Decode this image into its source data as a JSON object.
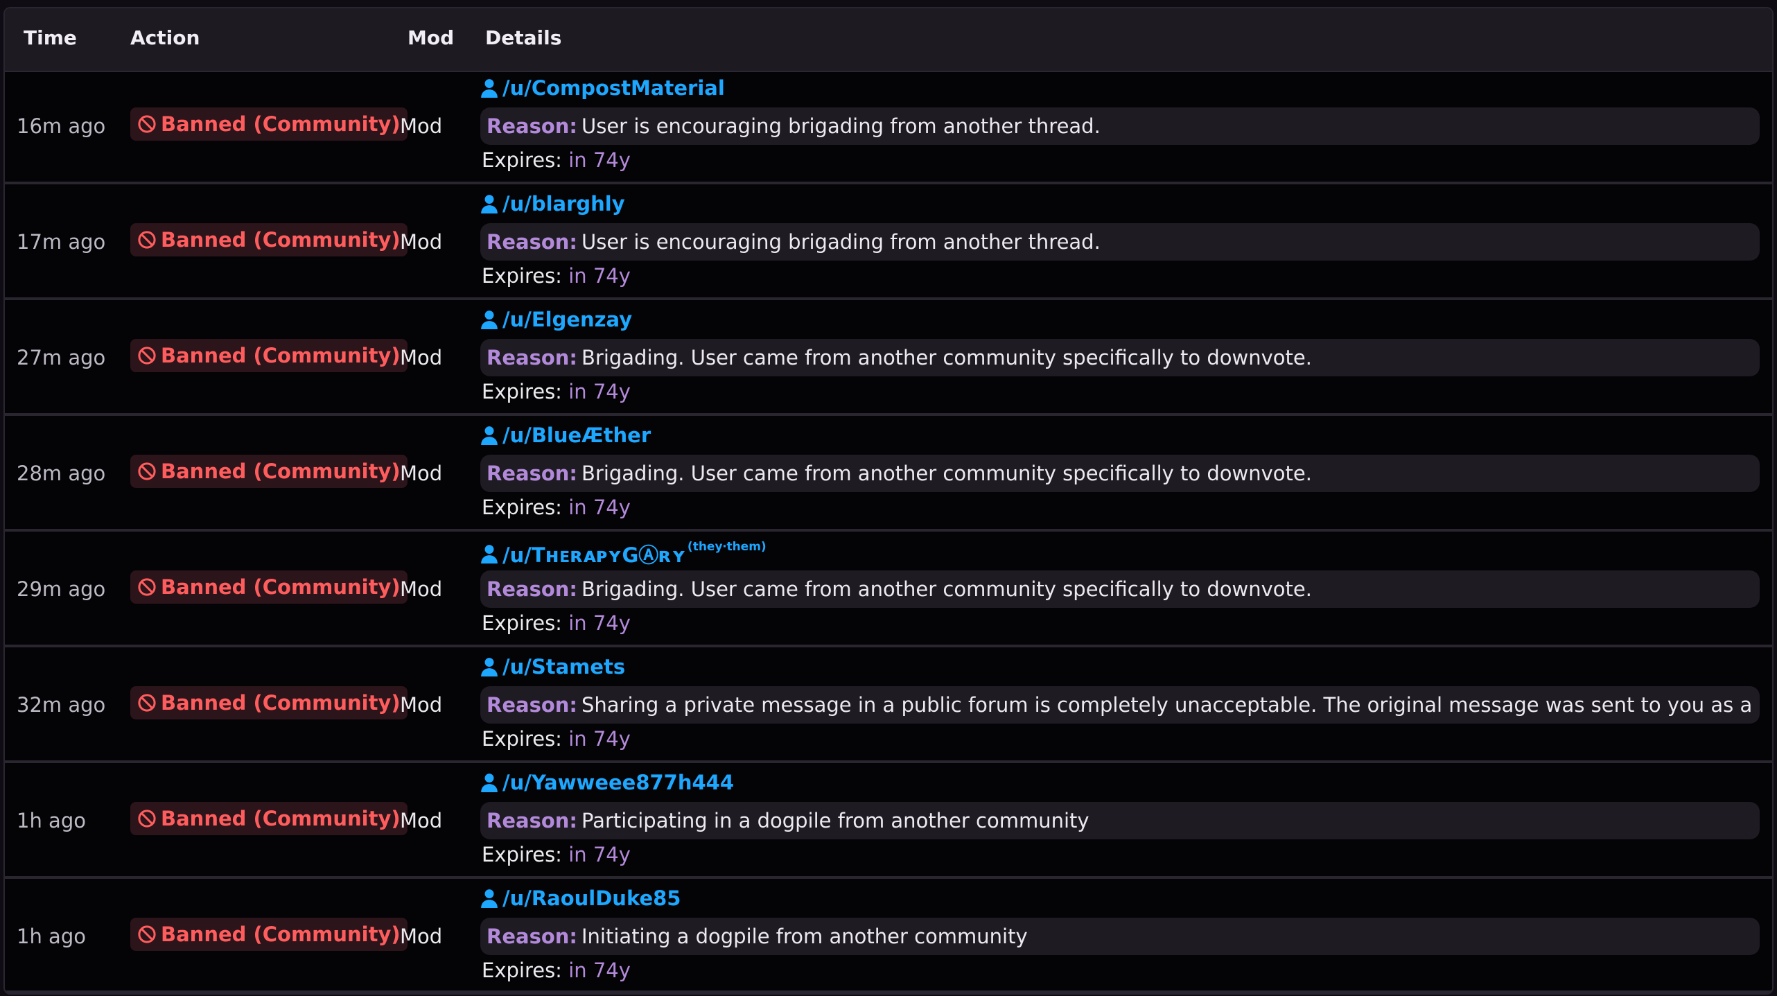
{
  "table": {
    "headers": {
      "time": "Time",
      "action": "Action",
      "mod": "Mod",
      "details": "Details"
    },
    "reason_label": "Reason:",
    "expires_label": "Expires:",
    "rows": [
      {
        "time": "16m ago",
        "action": "Banned (Community)",
        "mod": "Mod",
        "user": "/u/CompostMaterial",
        "pronouns": "",
        "reason": "User is encouraging brigading from another thread.",
        "expires": "in 74y"
      },
      {
        "time": "17m ago",
        "action": "Banned (Community)",
        "mod": "Mod",
        "user": "/u/blarghly",
        "pronouns": "",
        "reason": "User is encouraging brigading from another thread.",
        "expires": "in 74y"
      },
      {
        "time": "27m ago",
        "action": "Banned (Community)",
        "mod": "Mod",
        "user": "/u/Elgenzay",
        "pronouns": "",
        "reason": "Brigading. User came from another community specifically to downvote.",
        "expires": "in 74y"
      },
      {
        "time": "28m ago",
        "action": "Banned (Community)",
        "mod": "Mod",
        "user": "/u/BlueÆther",
        "pronouns": "",
        "reason": "Brigading. User came from another community specifically to downvote.",
        "expires": "in 74y"
      },
      {
        "time": "29m ago",
        "action": "Banned (Community)",
        "mod": "Mod",
        "user": "/u/TʜᴇʀᴀᴘʏGⒶʀʏ",
        "pronouns": "(they‧them)",
        "reason": "Brigading. User came from another community specifically to downvote.",
        "expires": "in 74y"
      },
      {
        "time": "32m ago",
        "action": "Banned (Community)",
        "mod": "Mod",
        "user": "/u/Stamets",
        "pronouns": "",
        "reason": "Sharing a private message in a public forum is completely unacceptable. The original message was sent to you as a courtesy.",
        "expires": "in 74y"
      },
      {
        "time": "1h ago",
        "action": "Banned (Community)",
        "mod": "Mod",
        "user": "/u/Yawweee877h444",
        "pronouns": "",
        "reason": "Participating in a dogpile from another community",
        "expires": "in 74y"
      },
      {
        "time": "1h ago",
        "action": "Banned (Community)",
        "mod": "Mod",
        "user": "/u/RaoulDuke85",
        "pronouns": "",
        "reason": "Initiating a dogpile from another community",
        "expires": "in 74y"
      }
    ]
  },
  "icons": {
    "ban": "ban-icon",
    "user": "user-icon"
  },
  "colors": {
    "ban_text": "#ff5d5d",
    "username": "#1ea7ff",
    "label_purple": "#b28ad9",
    "background": "#040306"
  }
}
